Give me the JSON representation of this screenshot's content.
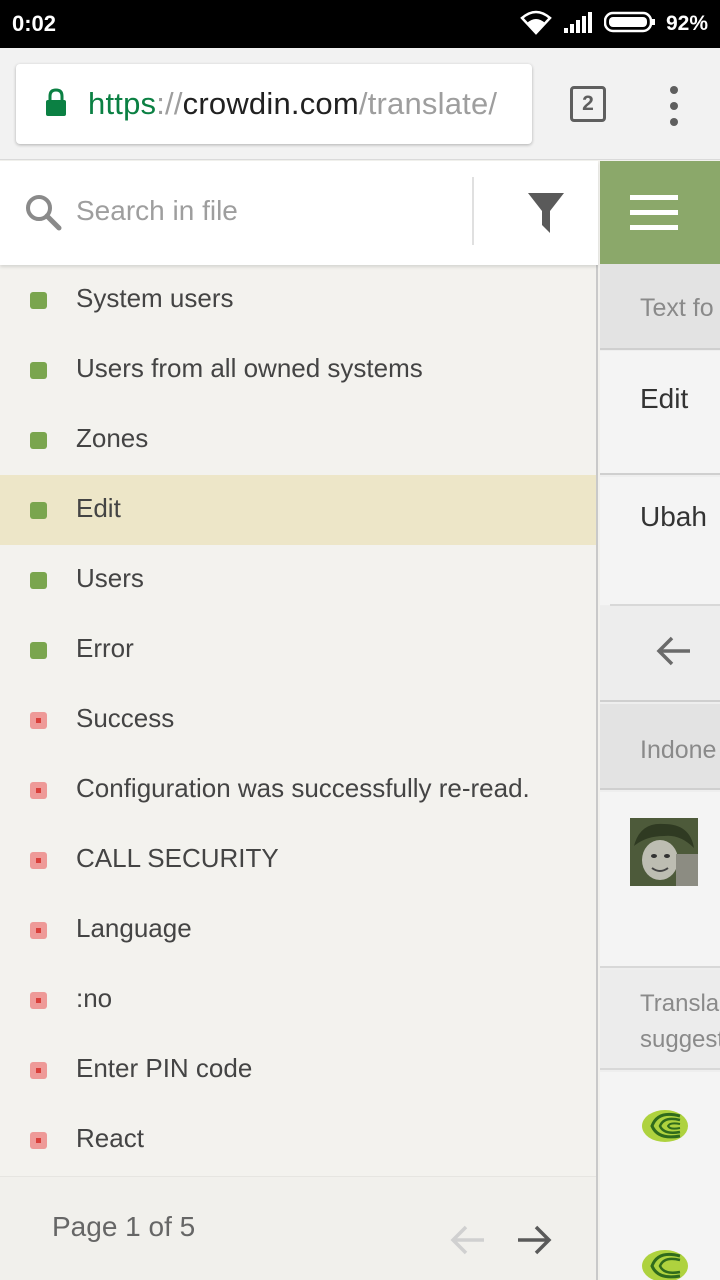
{
  "status_bar": {
    "time": "0:02",
    "battery_percent": "92%"
  },
  "browser": {
    "url_scheme": "https",
    "url_sep": "://",
    "url_host": "crowdin.com",
    "url_path": "/translate/",
    "tab_count": "2"
  },
  "sidebar": {
    "search_placeholder": "Search in file",
    "items": [
      {
        "label": "System users",
        "status": "translated"
      },
      {
        "label": "Users from all owned systems",
        "status": "translated"
      },
      {
        "label": "Zones",
        "status": "translated"
      },
      {
        "label": "Edit",
        "status": "translated",
        "selected": true
      },
      {
        "label": "Users",
        "status": "translated"
      },
      {
        "label": "Error",
        "status": "translated"
      },
      {
        "label": "Success",
        "status": "untranslated"
      },
      {
        "label": "Configuration was successfully re-read.",
        "status": "untranslated"
      },
      {
        "label": "CALL SECURITY",
        "status": "untranslated"
      },
      {
        "label": "Language",
        "status": "untranslated"
      },
      {
        "label": ":no",
        "status": "untranslated"
      },
      {
        "label": "Enter PIN code",
        "status": "untranslated"
      },
      {
        "label": "React",
        "status": "untranslated"
      }
    ],
    "pager_text": "Page 1 of 5"
  },
  "editor": {
    "section_label": "Text fo",
    "source_text": "Edit",
    "translation_text": "Ubah",
    "language_label": "Indone",
    "suggest_line1": "Transla",
    "suggest_line2": "suggest"
  },
  "colors": {
    "accent_green": "#8ba86a",
    "translated_dot": "#7aa54e",
    "untranslated_dot": "#ee9a98",
    "selected_row": "#ede6c8"
  }
}
